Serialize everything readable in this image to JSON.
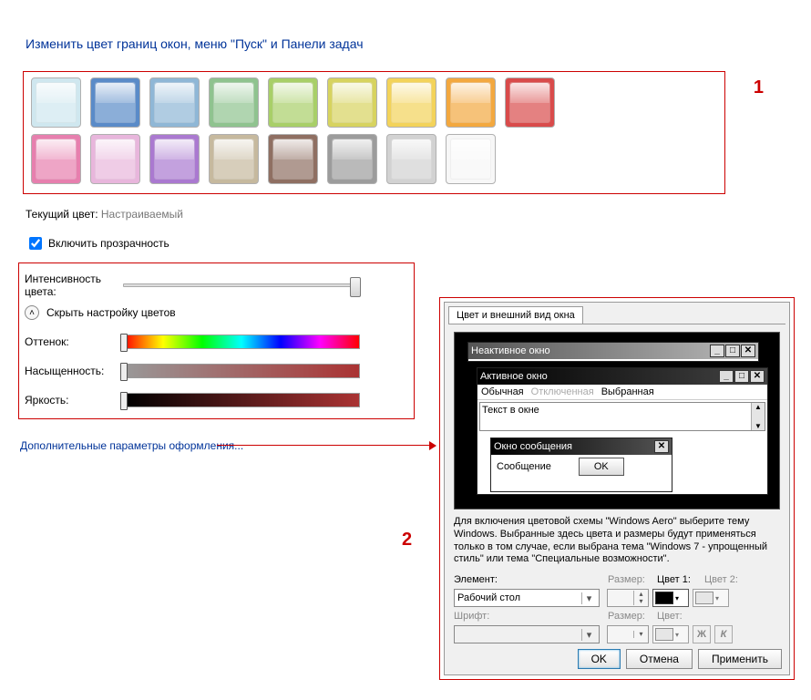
{
  "title": "Изменить цвет границ окон, меню \"Пуск\" и Панели задач",
  "labels": {
    "l1": "1",
    "l2": "2"
  },
  "swatches_row1": [
    "#cfe7ef",
    "#5a8bc8",
    "#8fb7d6",
    "#8fc38f",
    "#a8cf68",
    "#d7d35f",
    "#f3d35a",
    "#f3a83f",
    "#d94b4b"
  ],
  "swatches_row2": [
    "#e77fae",
    "#e8b6dc",
    "#aa79d0",
    "#c6b99e",
    "#8f6f62",
    "#9c9c9c",
    "#d2d2d2",
    "#f7f7f7"
  ],
  "current_label": "Текущий цвет:",
  "current_value": "Настраиваемый",
  "transparency": {
    "checked": true,
    "label": "Включить прозрачность"
  },
  "intensity": {
    "label": "Интенсивность цвета:",
    "pos": 100
  },
  "toggle": {
    "label": "Скрыть настройку цветов"
  },
  "hue": {
    "label": "Оттенок:",
    "pos": 0
  },
  "sat": {
    "label": "Насыщенность:",
    "pos": 0
  },
  "lum": {
    "label": "Яркость:",
    "pos": 0
  },
  "link": "Дополнительные параметры оформления...",
  "dialog": {
    "tab": "Цвет и внешний вид окна",
    "inactive": "Неактивное окно",
    "active": "Активное окно",
    "menu": {
      "m1": "Обычная",
      "m2": "Отключенная",
      "m3": "Выбранная"
    },
    "textarea": "Текст в окне",
    "msgbox": {
      "title": "Окно сообщения",
      "body": "Сообщение",
      "ok": "OK"
    },
    "note": "Для включения цветовой схемы \"Windows Aero\" выберите тему Windows.  Выбранные здесь цвета и размеры будут применяться только в том случае, если выбрана тема \"Windows 7 - упрощенный стиль\" или тема \"Специальные возможности\".",
    "element_lbl": "Элемент:",
    "element_val": "Рабочий стол",
    "size_lbl": "Размер:",
    "color1_lbl": "Цвет 1:",
    "color2_lbl": "Цвет 2:",
    "font_lbl": "Шрифт:",
    "color_lbl": "Цвет:",
    "ok": "OK",
    "cancel": "Отмена",
    "apply": "Применить",
    "bold": "Ж",
    "italic": "К",
    "color1_value": "#000000"
  }
}
